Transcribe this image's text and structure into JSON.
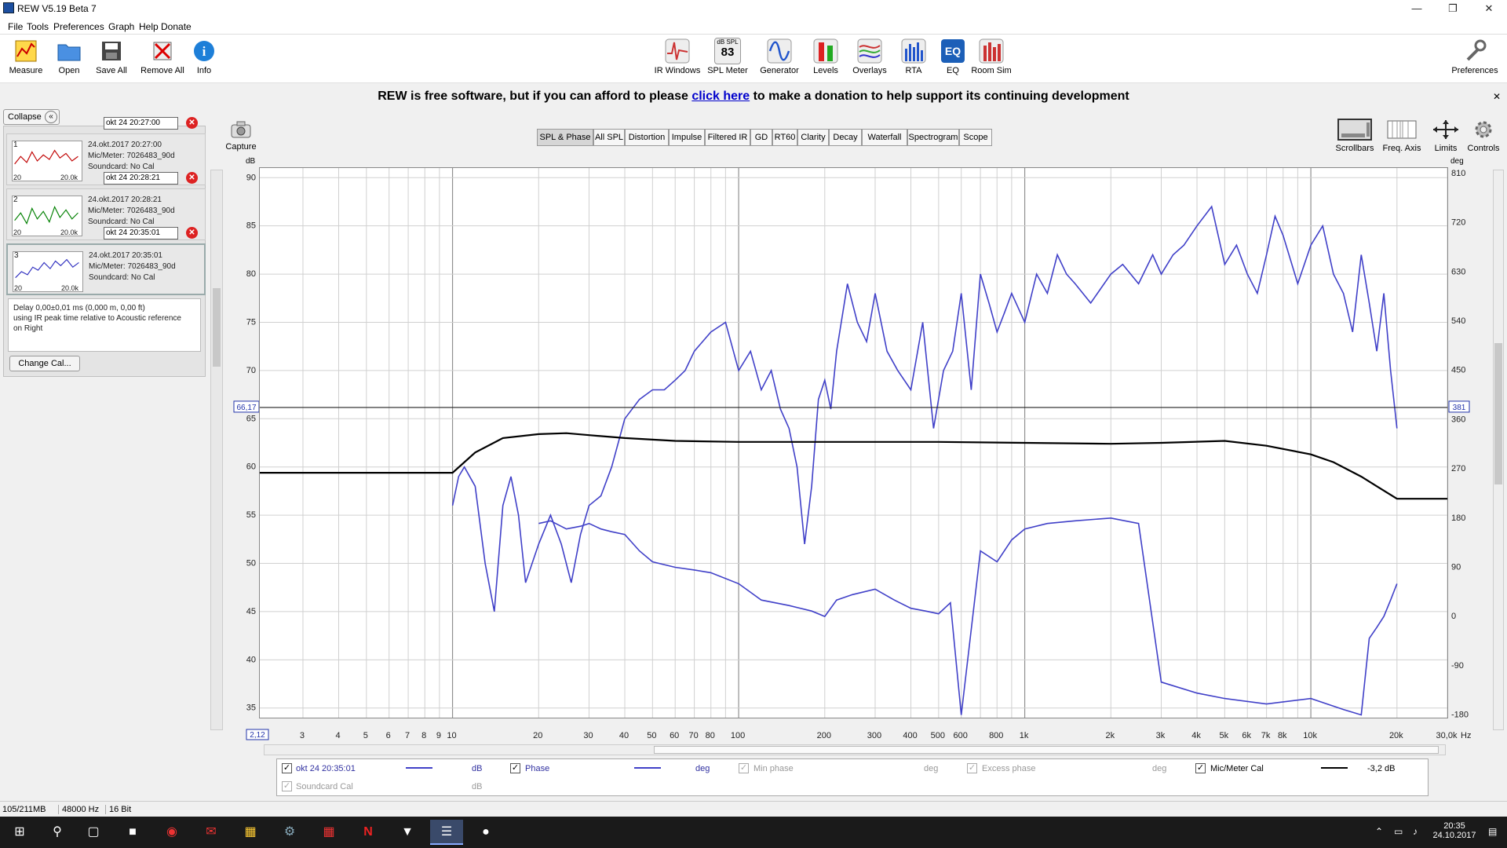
{
  "window": {
    "title": "REW V5.19 Beta 7"
  },
  "menu": [
    "File",
    "Tools",
    "Preferences",
    "Graph",
    "Help",
    "Donate"
  ],
  "toolbar_left": [
    "Measure",
    "Open",
    "Save All",
    "Remove All",
    "Info"
  ],
  "toolbar_center": [
    "IR Windows",
    "SPL Meter",
    "Generator",
    "Levels",
    "Overlays",
    "RTA",
    "EQ",
    "Room Sim"
  ],
  "spl_meter": {
    "top": "dB SPL",
    "value": "83"
  },
  "toolbar_right": "Preferences",
  "banner": {
    "pre": "REW is free software, but if you can afford to please ",
    "link": "click here",
    "post": " to make a donation to help support its continuing development"
  },
  "panel": {
    "collapse": "Collapse",
    "measurements": [
      {
        "num": "1",
        "name": "okt 24 20:27:00",
        "date": "24.okt.2017 20:27:00",
        "mic": "Mic/Meter: 7026483_90d",
        "sound": "Soundcard: No Cal",
        "color": "#c00000",
        "lo": "20",
        "hi": "20.0k"
      },
      {
        "num": "2",
        "name": "okt 24 20:28:21",
        "date": "24.okt.2017 20:28:21",
        "mic": "Mic/Meter: 7026483_90d",
        "sound": "Soundcard: No Cal",
        "color": "#008000",
        "lo": "20",
        "hi": "20.0k"
      },
      {
        "num": "3",
        "name": "okt 24 20:35:01",
        "date": "24.okt.2017 20:35:01",
        "mic": "Mic/Meter: 7026483_90d",
        "sound": "Soundcard: No Cal",
        "color": "#3030c0",
        "lo": "20",
        "hi": "20.0k"
      }
    ],
    "delay_lines": [
      "Delay 0,00±0,01 ms (0,000 m, 0,00 ft)",
      "using IR peak time relative to Acoustic reference",
      "on  Right"
    ],
    "change_cal": "Change Cal..."
  },
  "capture": "Capture",
  "graph_tabs": [
    "SPL & Phase",
    "All SPL",
    "Distortion",
    "Impulse",
    "Filtered IR",
    "GD",
    "RT60",
    "Clarity",
    "Decay",
    "Waterfall",
    "Spectrogram",
    "Scope"
  ],
  "active_tab": "SPL & Phase",
  "right_buttons": [
    "Scrollbars",
    "Freq. Axis",
    "Limits",
    "Controls"
  ],
  "chart_data": {
    "type": "line",
    "xscale": "log",
    "xlim": [
      2.12,
      30000
    ],
    "x_ticks": [
      {
        "v": 3,
        "t": "3"
      },
      {
        "v": 4,
        "t": "4"
      },
      {
        "v": 5,
        "t": "5"
      },
      {
        "v": 6,
        "t": "6"
      },
      {
        "v": 7,
        "t": "7"
      },
      {
        "v": 8,
        "t": "8"
      },
      {
        "v": 9,
        "t": "9"
      },
      {
        "v": 10,
        "t": "10"
      },
      {
        "v": 20,
        "t": "20"
      },
      {
        "v": 30,
        "t": "30"
      },
      {
        "v": 40,
        "t": "40"
      },
      {
        "v": 50,
        "t": "50"
      },
      {
        "v": 60,
        "t": "60"
      },
      {
        "v": 70,
        "t": "70"
      },
      {
        "v": 80,
        "t": "80"
      },
      {
        "v": 100,
        "t": "100"
      },
      {
        "v": 200,
        "t": "200"
      },
      {
        "v": 300,
        "t": "300"
      },
      {
        "v": 400,
        "t": "400"
      },
      {
        "v": 500,
        "t": "500"
      },
      {
        "v": 600,
        "t": "600"
      },
      {
        "v": 800,
        "t": "800"
      },
      {
        "v": 1000,
        "t": "1k"
      },
      {
        "v": 2000,
        "t": "2k"
      },
      {
        "v": 3000,
        "t": "3k"
      },
      {
        "v": 4000,
        "t": "4k"
      },
      {
        "v": 5000,
        "t": "5k"
      },
      {
        "v": 6000,
        "t": "6k"
      },
      {
        "v": 7000,
        "t": "7k"
      },
      {
        "v": 8000,
        "t": "8k"
      },
      {
        "v": 10000,
        "t": "10k"
      },
      {
        "v": 20000,
        "t": "20k"
      },
      {
        "v": 30000,
        "t": "30,0k"
      }
    ],
    "x_min_label": "2,12",
    "x_unit": "Hz",
    "y_left": {
      "label": "dB",
      "lim": [
        34,
        91
      ],
      "ticks": [
        35,
        40,
        45,
        50,
        55,
        60,
        65,
        70,
        75,
        80,
        85,
        90
      ]
    },
    "y_right": {
      "label": "deg",
      "lim": [
        -185,
        820
      ],
      "ticks": [
        "-180",
        "-90",
        "0",
        "90",
        "180",
        "270",
        "360",
        "450",
        "540",
        "630",
        "720",
        "810"
      ]
    },
    "cursor": {
      "db": "66,17",
      "deg": "381",
      "y_db": 66.17
    },
    "series": [
      {
        "name": "okt 24 20:35:01",
        "color": "#4040c8",
        "x": [
          10,
          10.5,
          11,
          12,
          13,
          14,
          15,
          16,
          17,
          18,
          20,
          22,
          24,
          26,
          28,
          30,
          33,
          36,
          40,
          45,
          50,
          55,
          60,
          65,
          70,
          80,
          90,
          100,
          110,
          120,
          130,
          140,
          150,
          160,
          170,
          180,
          190,
          200,
          210,
          220,
          240,
          260,
          280,
          300,
          330,
          360,
          400,
          440,
          480,
          520,
          560,
          600,
          650,
          700,
          750,
          800,
          850,
          900,
          1000,
          1100,
          1200,
          1300,
          1400,
          1500,
          1700,
          2000,
          2200,
          2500,
          2800,
          3000,
          3300,
          3600,
          4000,
          4500,
          5000,
          5500,
          6000,
          6500,
          7000,
          7500,
          8000,
          9000,
          10000,
          11000,
          12000,
          13000,
          14000,
          15000,
          16000,
          17000,
          18000,
          19000,
          20000
        ],
        "y": [
          56,
          59,
          60,
          58,
          50,
          45,
          56,
          59,
          55,
          48,
          52,
          55,
          52,
          48,
          53,
          56,
          57,
          60,
          65,
          67,
          68,
          68,
          69,
          70,
          72,
          74,
          75,
          70,
          72,
          68,
          70,
          66,
          64,
          60,
          52,
          58,
          67,
          69,
          66,
          72,
          79,
          75,
          73,
          78,
          72,
          70,
          68,
          75,
          64,
          70,
          72,
          78,
          68,
          80,
          77,
          74,
          76,
          78,
          75,
          80,
          78,
          82,
          80,
          79,
          77,
          80,
          81,
          79,
          82,
          80,
          82,
          83,
          85,
          87,
          81,
          83,
          80,
          78,
          82,
          86,
          84,
          79,
          83,
          85,
          80,
          78,
          74,
          82,
          77,
          72,
          78,
          70,
          64
        ],
        "label": "dB"
      },
      {
        "name": "Phase",
        "color": "#4040c8",
        "x": [
          20,
          22,
          25,
          28,
          30,
          33,
          36,
          40,
          45,
          50,
          60,
          70,
          80,
          100,
          120,
          150,
          180,
          200,
          220,
          250,
          300,
          350,
          400,
          450,
          500,
          550,
          600,
          700,
          800,
          900,
          1000,
          1200,
          1500,
          2000,
          2500,
          3000,
          4000,
          5000,
          7000,
          10000,
          13000,
          15000,
          16000,
          17000,
          18000,
          19000,
          20000
        ],
        "y": [
          170,
          175,
          160,
          165,
          170,
          160,
          155,
          150,
          120,
          100,
          90,
          85,
          80,
          60,
          30,
          20,
          10,
          0,
          30,
          40,
          50,
          30,
          15,
          10,
          5,
          25,
          -180,
          120,
          100,
          140,
          160,
          170,
          175,
          180,
          170,
          -120,
          -140,
          -150,
          -160,
          -150,
          -170,
          -180,
          -40,
          -20,
          0,
          30,
          60
        ],
        "label": "deg"
      },
      {
        "name": "Mic/Meter Cal",
        "color": "#000000",
        "x": [
          2.12,
          10,
          12,
          15,
          20,
          25,
          30,
          40,
          60,
          100,
          200,
          500,
          1000,
          2000,
          3000,
          5000,
          7000,
          10000,
          12000,
          15000,
          17000,
          20000,
          30000
        ],
        "y": [
          59.4,
          59.4,
          61.5,
          63,
          63.4,
          63.5,
          63.3,
          63,
          62.7,
          62.6,
          62.6,
          62.6,
          62.5,
          62.4,
          62.5,
          62.7,
          62.2,
          61.3,
          60.5,
          59,
          58,
          56.7,
          56.7
        ],
        "label": "-3,2 dB"
      }
    ]
  },
  "legend": {
    "row1": [
      {
        "label": "okt 24 20:35:01",
        "unit": "dB",
        "checked": true,
        "color": "#4040c8"
      },
      {
        "label": "Phase",
        "unit": "deg",
        "checked": true,
        "color": "#4040c8"
      },
      {
        "label": "Min phase",
        "unit": "deg",
        "checked": false,
        "color": ""
      },
      {
        "label": "Excess phase",
        "unit": "deg",
        "checked": false,
        "color": ""
      },
      {
        "label": "Mic/Meter Cal",
        "unit": "-3,2 dB",
        "checked": true,
        "color": "#000000"
      }
    ],
    "row2": {
      "label": "Soundcard Cal",
      "unit": "dB"
    }
  },
  "status": {
    "mem": "105/211MB",
    "rate": "48000 Hz",
    "bits": "16 Bit"
  },
  "clock": {
    "time": "20:35",
    "date": "24.10.2017"
  }
}
